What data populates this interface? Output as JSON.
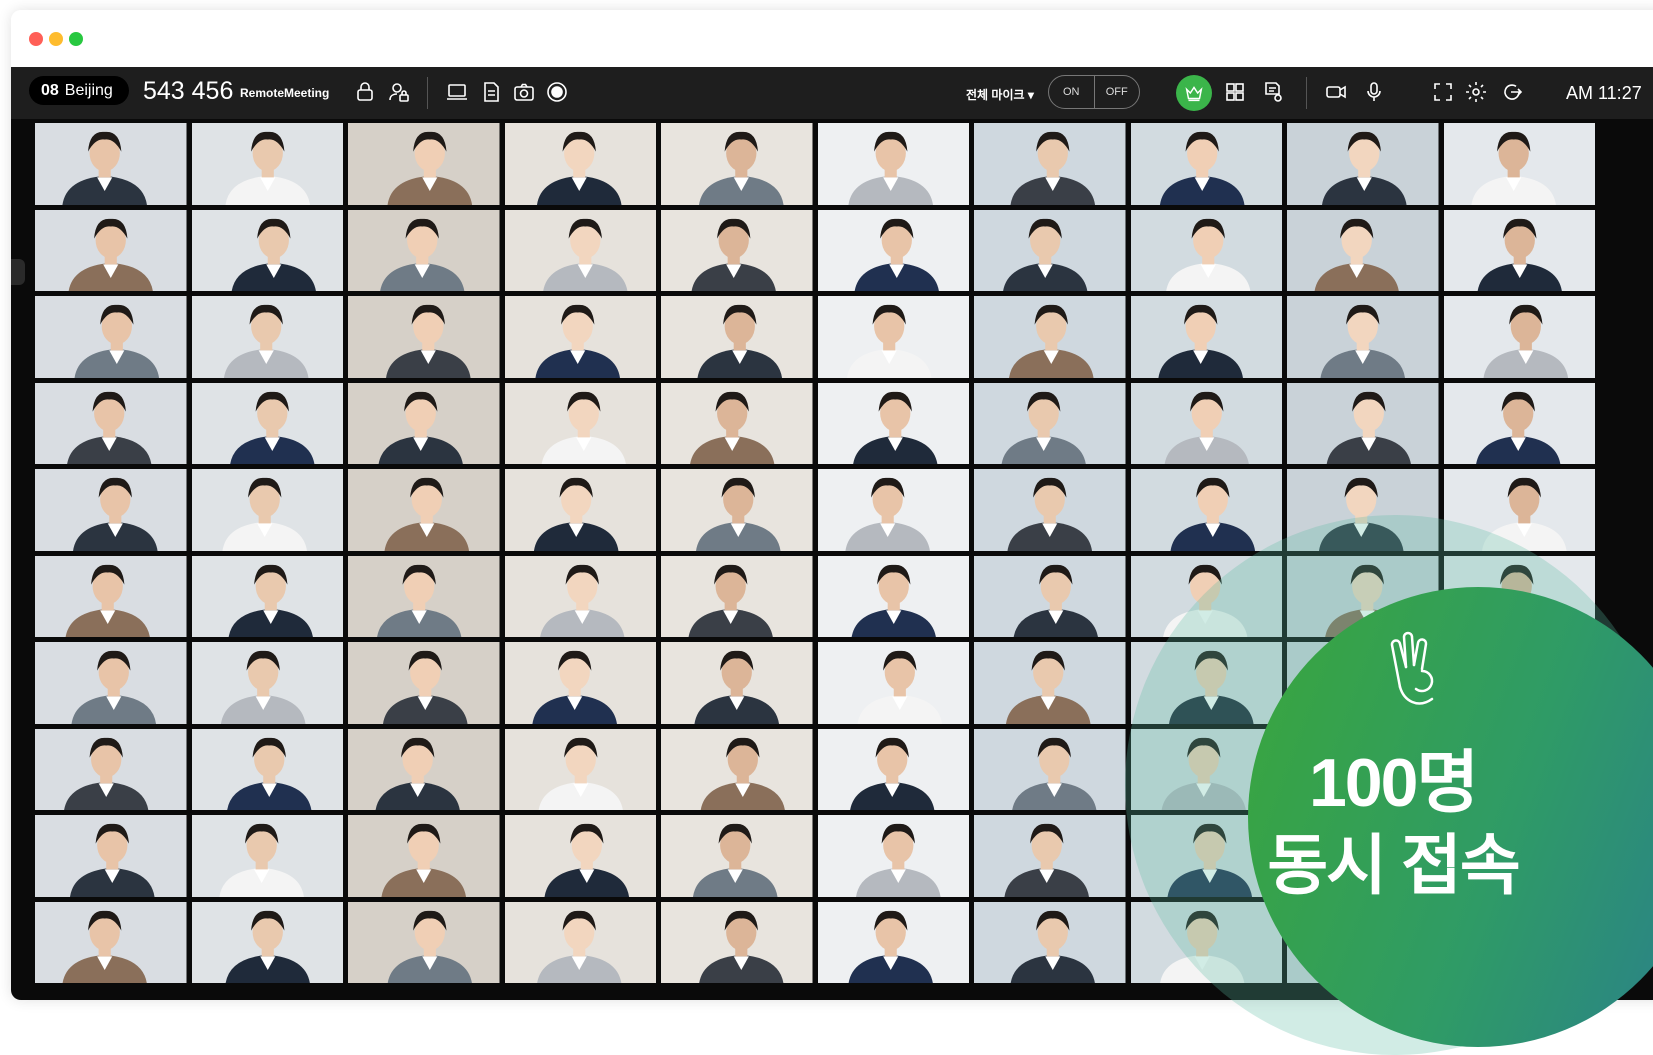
{
  "toolbar": {
    "room_number": "08",
    "room_city": "Beijing",
    "meeting_id": "543 456",
    "app_name": "RemoteMeeting",
    "mic_select": "전체 마이크 ▾",
    "on_label": "ON",
    "off_label": "OFF",
    "clock": "AM 11:27"
  },
  "colors": {
    "toolbar_bg": "#1e1e1e",
    "accent_green": "#3bb54a",
    "badge_gradient": [
      "#3aa63c",
      "#2a7f8c"
    ]
  },
  "icons": [
    "lock-icon",
    "user-lock-icon",
    "screen-share-icon",
    "document-icon",
    "camera-icon",
    "record-icon",
    "crown-icon",
    "grid-view-icon",
    "chat-document-icon",
    "video-camera-icon",
    "microphone-icon",
    "fullscreen-icon",
    "settings-icon",
    "exit-icon",
    "ok-hand-icon"
  ],
  "participants_count": 100,
  "badge": {
    "line1": "100명",
    "line2": "동시 접속"
  }
}
